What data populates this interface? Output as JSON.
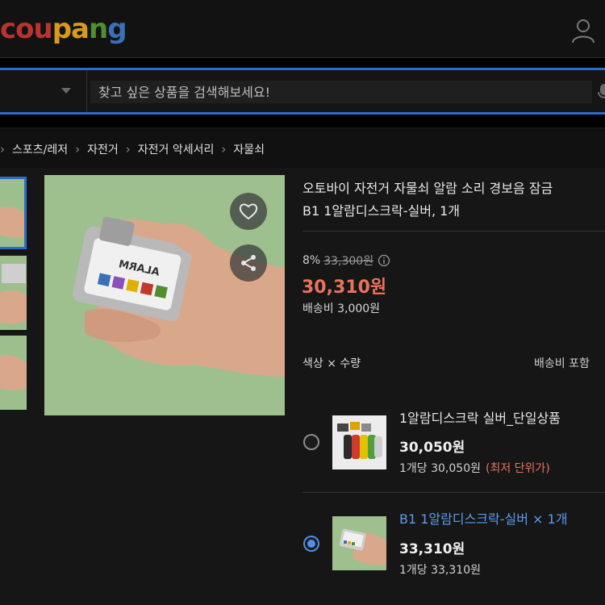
{
  "header": {
    "logo_parts": [
      "cou",
      "pa",
      "n",
      "g"
    ],
    "user_icon": "user-icon"
  },
  "search": {
    "placeholder": "찾고 싶은 상품을 검색해보세요!",
    "caret_icon": "caret-down-icon",
    "mic_icon": "mic-icon",
    "accent_color": "#2d6cc9"
  },
  "breadcrumb": {
    "items": [
      "스포츠/레저",
      "자전거",
      "자전거 악세서리",
      "자물쇠"
    ],
    "separator_icon": "chevron-right-icon"
  },
  "product": {
    "title_line1": "오토바이 자전거 자물쇠 알람 소리 경보음 잠금",
    "title_line2": "B1 1알람디스크락-실버, 1개",
    "discount": "8%",
    "original_price": "33,300원",
    "sale_price": "30,310원",
    "shipping": "배송비 3,000원",
    "lock_label_text": "ALARM",
    "sale_color": "#e8735d"
  },
  "gallery": {
    "wishlist_icon": "heart-icon",
    "share_icon": "share-icon",
    "thumbnails": 3
  },
  "options": {
    "label": "색상 × 수량",
    "shipping_included": "배송비 포함",
    "items": [
      {
        "name": "1알람디스크락 실버_단일상품",
        "price": "30,050원",
        "unit_price": "1개당 30,050원",
        "badge": "(최저 단위가)",
        "selected": false
      },
      {
        "name": "B1 1알람디스크락-실버 × 1개",
        "price": "33,310원",
        "unit_price": "1개당 33,310원",
        "selected": true
      }
    ],
    "selected_color": "#4f8fe6"
  }
}
